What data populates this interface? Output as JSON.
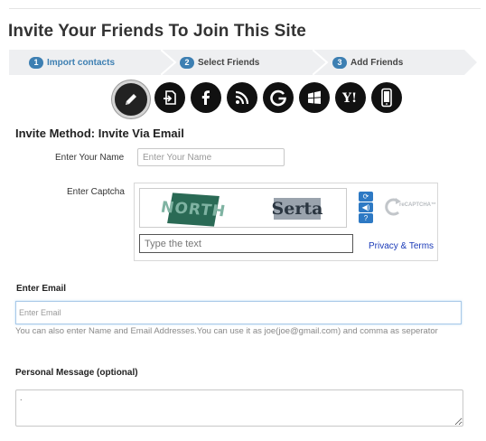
{
  "page": {
    "title": "Invite Your Friends To Join This Site"
  },
  "steps": [
    {
      "number": "1",
      "label": "Import contacts",
      "active": true
    },
    {
      "number": "2",
      "label": "Select Friends",
      "active": false
    },
    {
      "number": "3",
      "label": "Add Friends",
      "active": false
    }
  ],
  "methods": [
    {
      "icon": "pencil-icon",
      "selected": true
    },
    {
      "icon": "import-file-icon",
      "selected": false
    },
    {
      "icon": "facebook-icon",
      "selected": false
    },
    {
      "icon": "rss-icon",
      "selected": false
    },
    {
      "icon": "google-icon",
      "selected": false
    },
    {
      "icon": "windows-icon",
      "selected": false
    },
    {
      "icon": "yahoo-icon",
      "selected": false
    },
    {
      "icon": "mobile-phone-icon",
      "selected": false
    }
  ],
  "invite_method": {
    "title": "Invite Method: Invite Via Email"
  },
  "name_field": {
    "label": "Enter Your Name",
    "placeholder": "Enter Your Name",
    "value": ""
  },
  "captcha": {
    "label": "Enter Captcha",
    "word1": "NORTH",
    "word2": "Serta",
    "placeholder": "Type the text",
    "privacy": "Privacy & Terms",
    "logo_text": "reCAPTCHA™",
    "colors": {
      "button": "#2d79c4",
      "link": "#1a3ab8"
    }
  },
  "email_field": {
    "label": "Enter Email",
    "placeholder": "Enter Email",
    "help": "You can also enter Name and Email Addresses.You can use it as joe(joe@gmail.com) and comma as seperator"
  },
  "message_field": {
    "label": "Personal Message (optional)",
    "value": "."
  },
  "colors": {
    "accent": "#3d7fb2",
    "step_bg": "#eeeff1"
  }
}
